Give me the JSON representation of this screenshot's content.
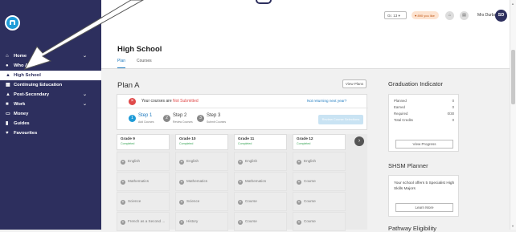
{
  "sidebar": {
    "logo_icon": "building-icon",
    "items": [
      {
        "label": "Home",
        "icon": "home-icon",
        "glyph": "⌂",
        "chevron": true,
        "active": false
      },
      {
        "label": "Who Am I",
        "icon": "user-circle-icon",
        "glyph": "●",
        "chevron": false,
        "active": false
      },
      {
        "label": "High School",
        "icon": "graduation-cap-icon",
        "glyph": "▲",
        "chevron": false,
        "active": true
      },
      {
        "label": "Continuing Education",
        "icon": "book-icon",
        "glyph": "▦",
        "chevron": false,
        "active": false
      },
      {
        "label": "Post-Secondary",
        "icon": "building-icon",
        "glyph": "▲",
        "chevron": true,
        "active": false
      },
      {
        "label": "Work",
        "icon": "briefcase-icon",
        "glyph": "■",
        "chevron": true,
        "active": false
      },
      {
        "label": "Money",
        "icon": "money-icon",
        "glyph": "▭",
        "chevron": false,
        "active": false
      },
      {
        "label": "Guides",
        "icon": "guide-icon",
        "glyph": "▮",
        "chevron": false,
        "active": false
      },
      {
        "label": "Favourites",
        "icon": "heart-icon",
        "glyph": "♥",
        "chevron": false,
        "active": false
      }
    ]
  },
  "topbar": {
    "grade": "Gr. 13 ▾",
    "favourites": "♥ 890 you like",
    "user_name": "Mrs Durbacz",
    "avatar": "SD"
  },
  "header": {
    "title": "High School",
    "tabs": [
      "Plan",
      "Courses"
    ]
  },
  "plan": {
    "title": "Plan A",
    "view_plans": "View Plans",
    "status_prefix": "Your courses are ",
    "status_value": "Not Submitted",
    "not_returning": "Not returning next year?",
    "steps": [
      {
        "num": "1",
        "title": "Step 1",
        "sub": "Add Courses",
        "active": true
      },
      {
        "num": "2",
        "title": "Step 2",
        "sub": "Review Courses",
        "active": false
      },
      {
        "num": "3",
        "title": "Step 3",
        "sub": "Submit Courses",
        "active": false
      }
    ],
    "review_button": "Review Course Selections",
    "next_icon": "›",
    "grades": [
      {
        "name": "Grade 9",
        "status": "Completed",
        "courses": [
          "English",
          "Mathematics",
          "Science",
          "French as a Second ..."
        ]
      },
      {
        "name": "Grade 10",
        "status": "Completed",
        "courses": [
          "English",
          "Mathematics",
          "Science",
          "History"
        ]
      },
      {
        "name": "Grade 11",
        "status": "Completed",
        "courses": [
          "English",
          "Mathematics",
          "Course",
          "Course"
        ]
      },
      {
        "name": "Grade 12",
        "status": "Completed",
        "courses": [
          "English",
          "Course",
          "Course",
          "Course"
        ]
      }
    ]
  },
  "graduation": {
    "title": "Graduation Indicator",
    "rows": [
      {
        "label": "Planned",
        "value": "0"
      },
      {
        "label": "Earned",
        "value": "0"
      },
      {
        "label": "Required",
        "value": "0/30"
      },
      {
        "label": "Total Credits",
        "value": "0"
      }
    ],
    "button": "View Progress"
  },
  "shsm": {
    "title": "SHSM Planner",
    "text": "Your school offers 5 Specialist High Skills Majors",
    "button": "Learn More"
  },
  "pathway": {
    "title": "Pathway Eligibility"
  },
  "colors": {
    "sidebar": "#2d2f5e",
    "accent": "#1e7abf",
    "alert": "#e04a4a",
    "completed": "#3aa657"
  }
}
